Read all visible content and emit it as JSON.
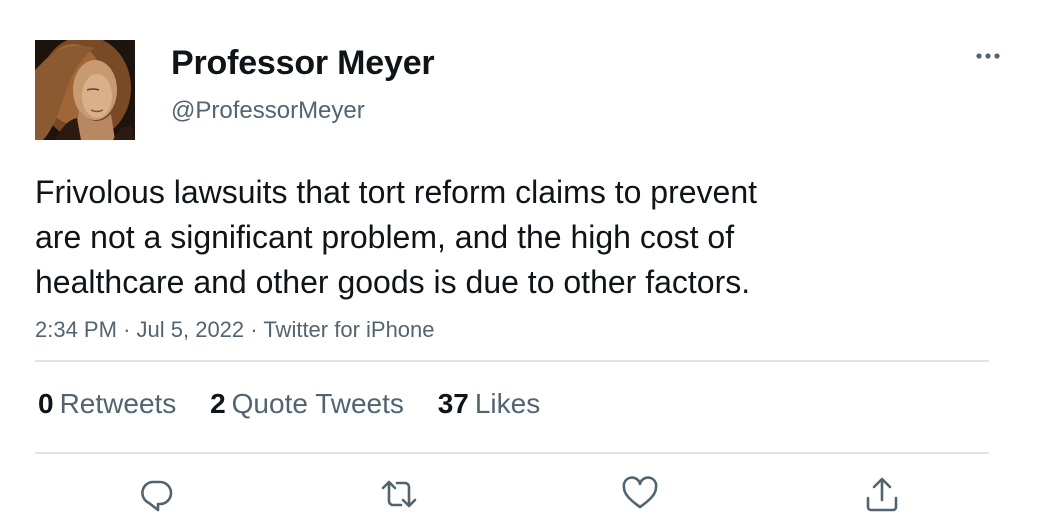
{
  "author": {
    "display_name": "Professor Meyer",
    "handle": "@ProfessorMeyer"
  },
  "tweet": {
    "text_lines": [
      "Frivolous lawsuits that tort reform claims to prevent",
      "are not a significant problem, and the high cost of",
      "healthcare and other goods is due to other factors."
    ],
    "time": "2:34 PM",
    "separator": "·",
    "date": "Jul 5, 2022",
    "source": "Twitter for iPhone"
  },
  "stats": {
    "retweets": {
      "count": "0",
      "label": "Retweets"
    },
    "quote_tweets": {
      "count": "2",
      "label": "Quote Tweets"
    },
    "likes": {
      "count": "37",
      "label": "Likes"
    }
  },
  "icons": {
    "more": "more-horizontal-icon",
    "reply": "reply-icon",
    "retweet": "retweet-icon",
    "like": "heart-icon",
    "share": "share-icon"
  },
  "colors": {
    "text_primary": "#0f1419",
    "text_secondary": "#536471",
    "divider": "#e1e4e6"
  }
}
